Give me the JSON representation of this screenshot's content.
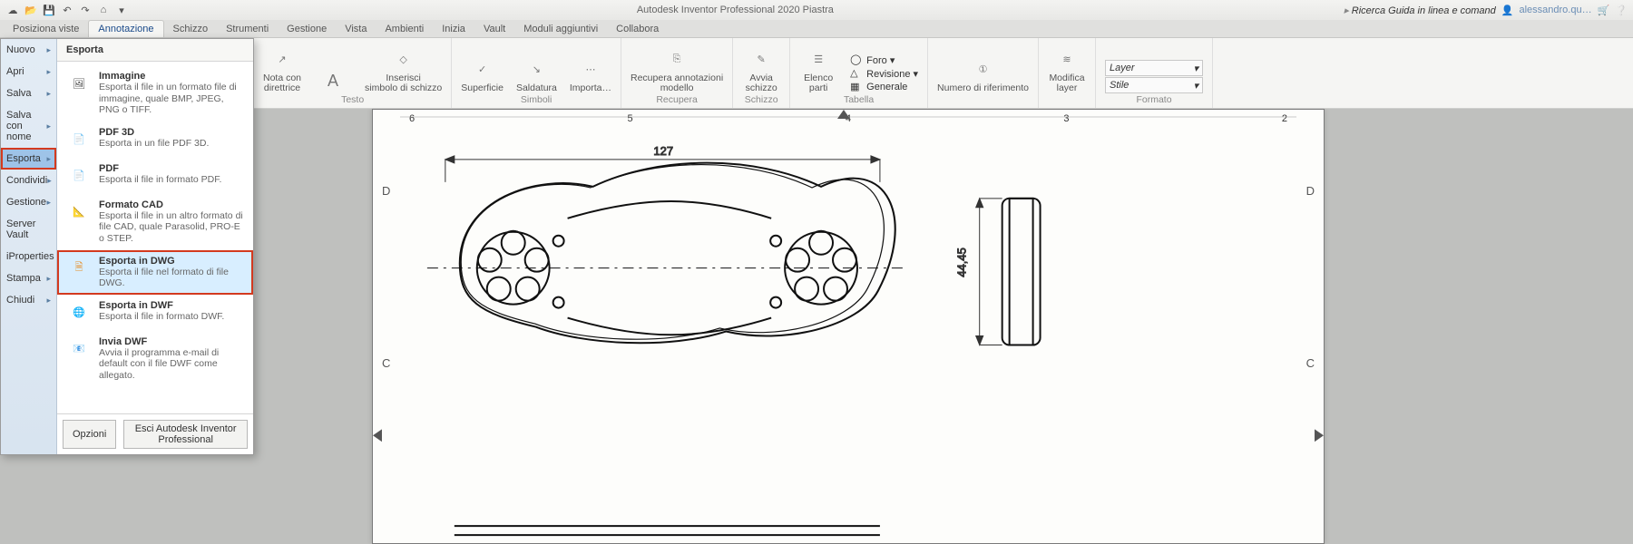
{
  "app": {
    "title": "Autodesk Inventor Professional 2020   Piastra",
    "search_ph": "Ricerca Guida in linea e comand",
    "user": "alessandro.qu…"
  },
  "tabs": [
    "Posiziona viste",
    "Annotazione",
    "Schizzo",
    "Strumenti",
    "Gestione",
    "Vista",
    "Ambienti",
    "Inizia",
    "Vault",
    "Moduli aggiuntivi",
    "Collabora"
  ],
  "active_tab": 1,
  "ribbon": {
    "groups": [
      {
        "label": "Testo",
        "items": [
          {
            "icon": "note",
            "label": "Nota con\ndirettrice"
          },
          {
            "icon": "A",
            "label": "A"
          },
          {
            "icon": "symbol",
            "label": "Inserisci\nsimbolo di schizzo"
          }
        ]
      },
      {
        "label": "Simboli",
        "items": [
          {
            "icon": "surf",
            "label": "Superficie"
          },
          {
            "icon": "weld",
            "label": "Saldatura"
          },
          {
            "icon": "imp",
            "label": "Importa…"
          }
        ]
      },
      {
        "label": "Recupera",
        "items": [
          {
            "icon": "recover",
            "label": "Recupera annotazioni\nmodello"
          }
        ]
      },
      {
        "label": "Schizzo",
        "items": [
          {
            "icon": "sketch",
            "label": "Avvia\nschizzo"
          }
        ]
      },
      {
        "label": "Tabella",
        "items": [
          {
            "icon": "parts",
            "label": "Elenco\nparti"
          }
        ],
        "vrows": [
          {
            "icon": "hole",
            "label": "Foro ▾"
          },
          {
            "icon": "rev",
            "label": "Revisione ▾"
          },
          {
            "icon": "gen",
            "label": "Generale"
          }
        ]
      },
      {
        "label": "",
        "items": [
          {
            "icon": "balloon",
            "label": "Numero di riferimento"
          }
        ]
      },
      {
        "label": "",
        "items": [
          {
            "icon": "layers",
            "label": "Modifica\nlayer"
          }
        ]
      },
      {
        "label": "Formato",
        "combos": [
          "Layer",
          "Stile"
        ]
      }
    ]
  },
  "appmenu": {
    "header": "Esporta",
    "left_items": [
      "Nuovo",
      "Apri",
      "Salva",
      "Salva con nome",
      "Esporta",
      "Condividi",
      "Gestione",
      "Server Vault",
      "iProperties",
      "Stampa",
      "Chiudi"
    ],
    "left_selected": 4,
    "options": [
      {
        "icon": "img",
        "title": "Immagine",
        "desc": "Esporta il file in un formato file di immagine, quale BMP, JPEG, PNG o TIFF."
      },
      {
        "icon": "pdf3d",
        "title": "PDF 3D",
        "desc": "Esporta in un file PDF 3D."
      },
      {
        "icon": "pdf",
        "title": "PDF",
        "desc": "Esporta il file in formato PDF."
      },
      {
        "icon": "cad",
        "title": "Formato CAD",
        "desc": "Esporta il file in un altro formato di file CAD, quale Parasolid, PRO-E o STEP."
      },
      {
        "icon": "dwg",
        "title": "Esporta in DWG",
        "desc": "Esporta il file nel formato di file DWG."
      },
      {
        "icon": "dwf",
        "title": "Esporta in DWF",
        "desc": "Esporta il file in formato DWF."
      },
      {
        "icon": "send",
        "title": "Invia DWF",
        "desc": "Avvia il programma e-mail di default con il file DWF come allegato."
      }
    ],
    "selected_option": 4,
    "buttons": [
      "Opzioni",
      "Esci Autodesk Inventor Professional"
    ]
  },
  "drawing": {
    "ruler_top": [
      "6",
      "5",
      "4",
      "3",
      "2"
    ],
    "side_letters": [
      "D",
      "C",
      "D",
      "C"
    ],
    "dim_width": "127",
    "dim_height": "44,45"
  }
}
